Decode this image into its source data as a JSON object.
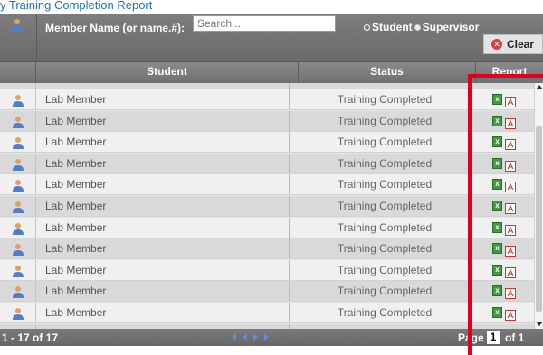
{
  "top_link": "y Training Completion Report",
  "filter": {
    "label": "Member Name (or name.#):",
    "search_placeholder": "Search...",
    "radio_student": "Student",
    "radio_supervisor": "Supervisor",
    "clear_label": "Clear"
  },
  "columns": {
    "student": "Student",
    "status": "Status",
    "report": "Report"
  },
  "rows": [
    {
      "name": "Lab Member",
      "status": "Training Completed"
    },
    {
      "name": "Lab Member",
      "status": "Training Completed"
    },
    {
      "name": "Lab Member",
      "status": "Training Completed"
    },
    {
      "name": "Lab Member",
      "status": "Training Completed"
    },
    {
      "name": "Lab Member",
      "status": "Training Completed"
    },
    {
      "name": "Lab Member",
      "status": "Training Completed"
    },
    {
      "name": "Lab Member",
      "status": "Training Completed"
    },
    {
      "name": "Lab Member",
      "status": "Training Completed"
    },
    {
      "name": "Lab Member",
      "status": "Training Completed"
    },
    {
      "name": "Lab Member",
      "status": "Training Completed"
    },
    {
      "name": "Lab Member",
      "status": "Training Completed"
    },
    {
      "name": "Lab Member",
      "status": "Training Completed"
    }
  ],
  "footer": {
    "range": "1 - 17 of 17",
    "page_label": "Page",
    "page_value": "1",
    "page_of": "of 1"
  },
  "colors": {
    "header_bg": "#7a7a7a",
    "link": "#1a75c9",
    "highlight": "#e0001a",
    "xls_icon": "#3f9b3f",
    "pdf_icon": "#d93025"
  }
}
